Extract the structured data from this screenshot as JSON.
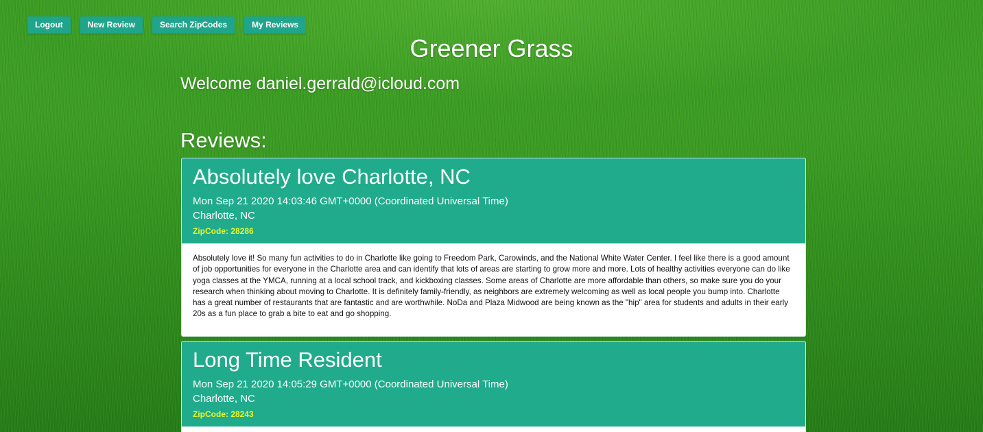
{
  "nav": {
    "logout": "Logout",
    "new_review": "New Review",
    "search_zipcodes": "Search ZipCodes",
    "my_reviews": "My Reviews"
  },
  "site_title": "Greener Grass",
  "welcome": "Welcome daniel.gerrald@icloud.com",
  "reviews_heading": "Reviews:",
  "reviews": [
    {
      "title": "Absolutely love Charlotte, NC",
      "date": "Mon Sep 21 2020 14:03:46 GMT+0000 (Coordinated Universal Time)",
      "location": "Charlotte, NC",
      "zip": "ZipCode: 28286",
      "body": "Absolutely love it! So many fun activities to do in Charlotte like going to Freedom Park, Carowinds, and the National White Water Center. I feel like there is a good amount of job opportunities for everyone in the Charlotte area and can identify that lots of areas are starting to grow more and more. Lots of healthy activities everyone can do like yoga classes at the YMCA, running at a local school track, and kickboxing classes. Some areas of Charlotte are more affordable than others, so make sure you do your research when thinking about moving to Charlotte. It is definitely family-friendly, as neighbors are extremely welcoming as well as local people you bump into. Charlotte has a great number of restaurants that are fantastic and are worthwhile. NoDa and Plaza Midwood are being known as the \"hip\" area for students and adults in their early 20s as a fun place to grab a bite to eat and go shopping."
    },
    {
      "title": "Long Time Resident",
      "date": "Mon Sep 21 2020 14:05:29 GMT+0000 (Coordinated Universal Time)",
      "location": "Charlotte, NC",
      "zip": "ZipCode: 28243"
    }
  ],
  "colors": {
    "accent": "#20ab8c",
    "button": "#1fa58b",
    "zip_text": "#e9f52a"
  }
}
